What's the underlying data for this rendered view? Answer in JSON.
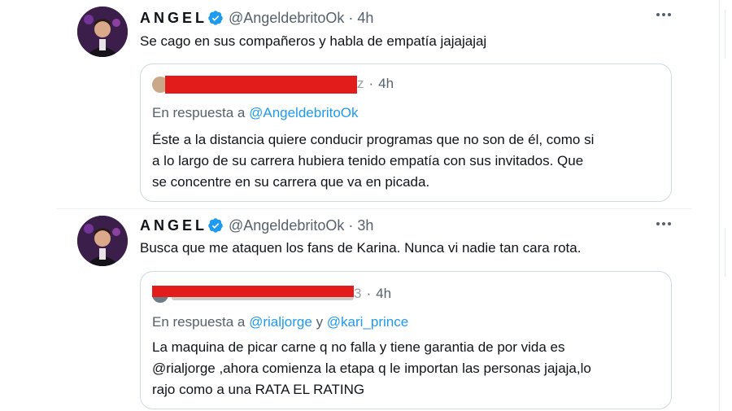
{
  "colors": {
    "accent": "#1d9bf0",
    "secondary_text": "#56616b",
    "redaction": "#e21b1b",
    "border": "#cfd9de"
  },
  "tweets": [
    {
      "author_name": "ANGEL",
      "verified_icon": "verified-badge-icon",
      "handle": "@AngeldebritoOk",
      "separator": "·",
      "time": "4h",
      "text": "Se cago en sus compañeros  y habla de empatía jajajajaj",
      "quote": {
        "time": "4h",
        "reply_prefix": "En respuesta a",
        "reply_mentions": [
          "@AngeldebritoOk"
        ],
        "reply_conjunction": "",
        "lines": [
          "Éste a la distancia quiere conducir programas que no son de él, como si",
          "a lo largo de su carrera hubiera tenido empatía con sus invitados. Que",
          "se concentre en su carrera que va en picada."
        ]
      }
    },
    {
      "author_name": "ANGEL",
      "verified_icon": "verified-badge-icon",
      "handle": "@AngeldebritoOk",
      "separator": "·",
      "time": "3h",
      "text": "Busca que me ataquen los fans de Karina. Nunca vi nadie tan cara rota.",
      "quote": {
        "time": "4h",
        "reply_prefix": "En respuesta a",
        "reply_mentions": [
          "@rialjorge",
          "@kari_prince"
        ],
        "reply_conjunction": "y",
        "lines": [
          "La maquina de picar carne  q no falla y tiene garantia de por vida es",
          "@rialjorge ,ahora comienza la etapa q le importan las personas jajaja,lo",
          "rajo como a una RATA EL RATING"
        ]
      }
    }
  ]
}
